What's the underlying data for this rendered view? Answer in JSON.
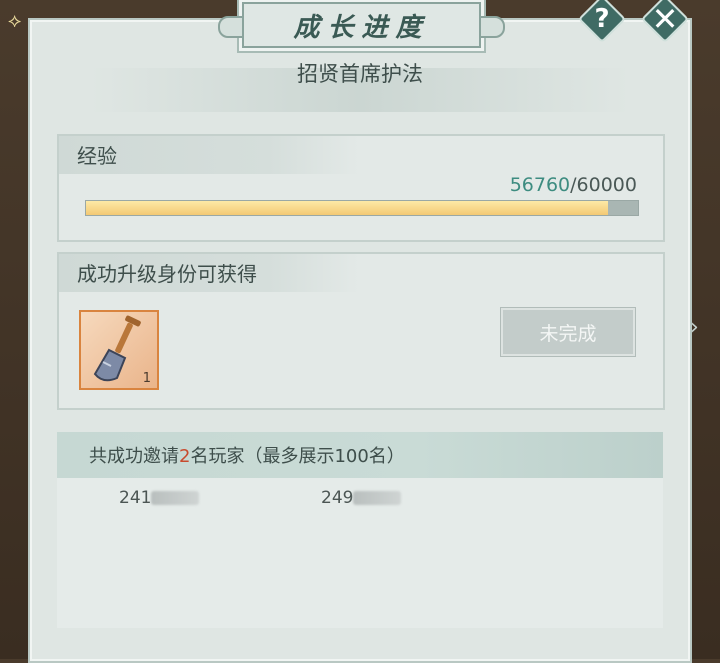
{
  "window": {
    "title": "成长进度",
    "help_symbol": "?",
    "close_symbol": "✕"
  },
  "rank": {
    "name": "招贤首席护法"
  },
  "experience": {
    "label": "经验",
    "current": "56760",
    "separator": "/",
    "max": "60000",
    "progress_fraction": 0.946
  },
  "reward": {
    "label": "成功升级身份可获得",
    "item_icon": "shovel-icon",
    "item_count": "1",
    "status_button": "未完成"
  },
  "invites": {
    "prefix": "共成功邀请",
    "count": "2",
    "suffix": "名玩家（最多展示100名）",
    "players": [
      {
        "id_visible": "241"
      },
      {
        "id_visible": "249"
      }
    ]
  },
  "colors": {
    "accent_teal": "#3d8c80",
    "highlight_red": "#c84a2d",
    "progress_gold": "#f3c974"
  }
}
